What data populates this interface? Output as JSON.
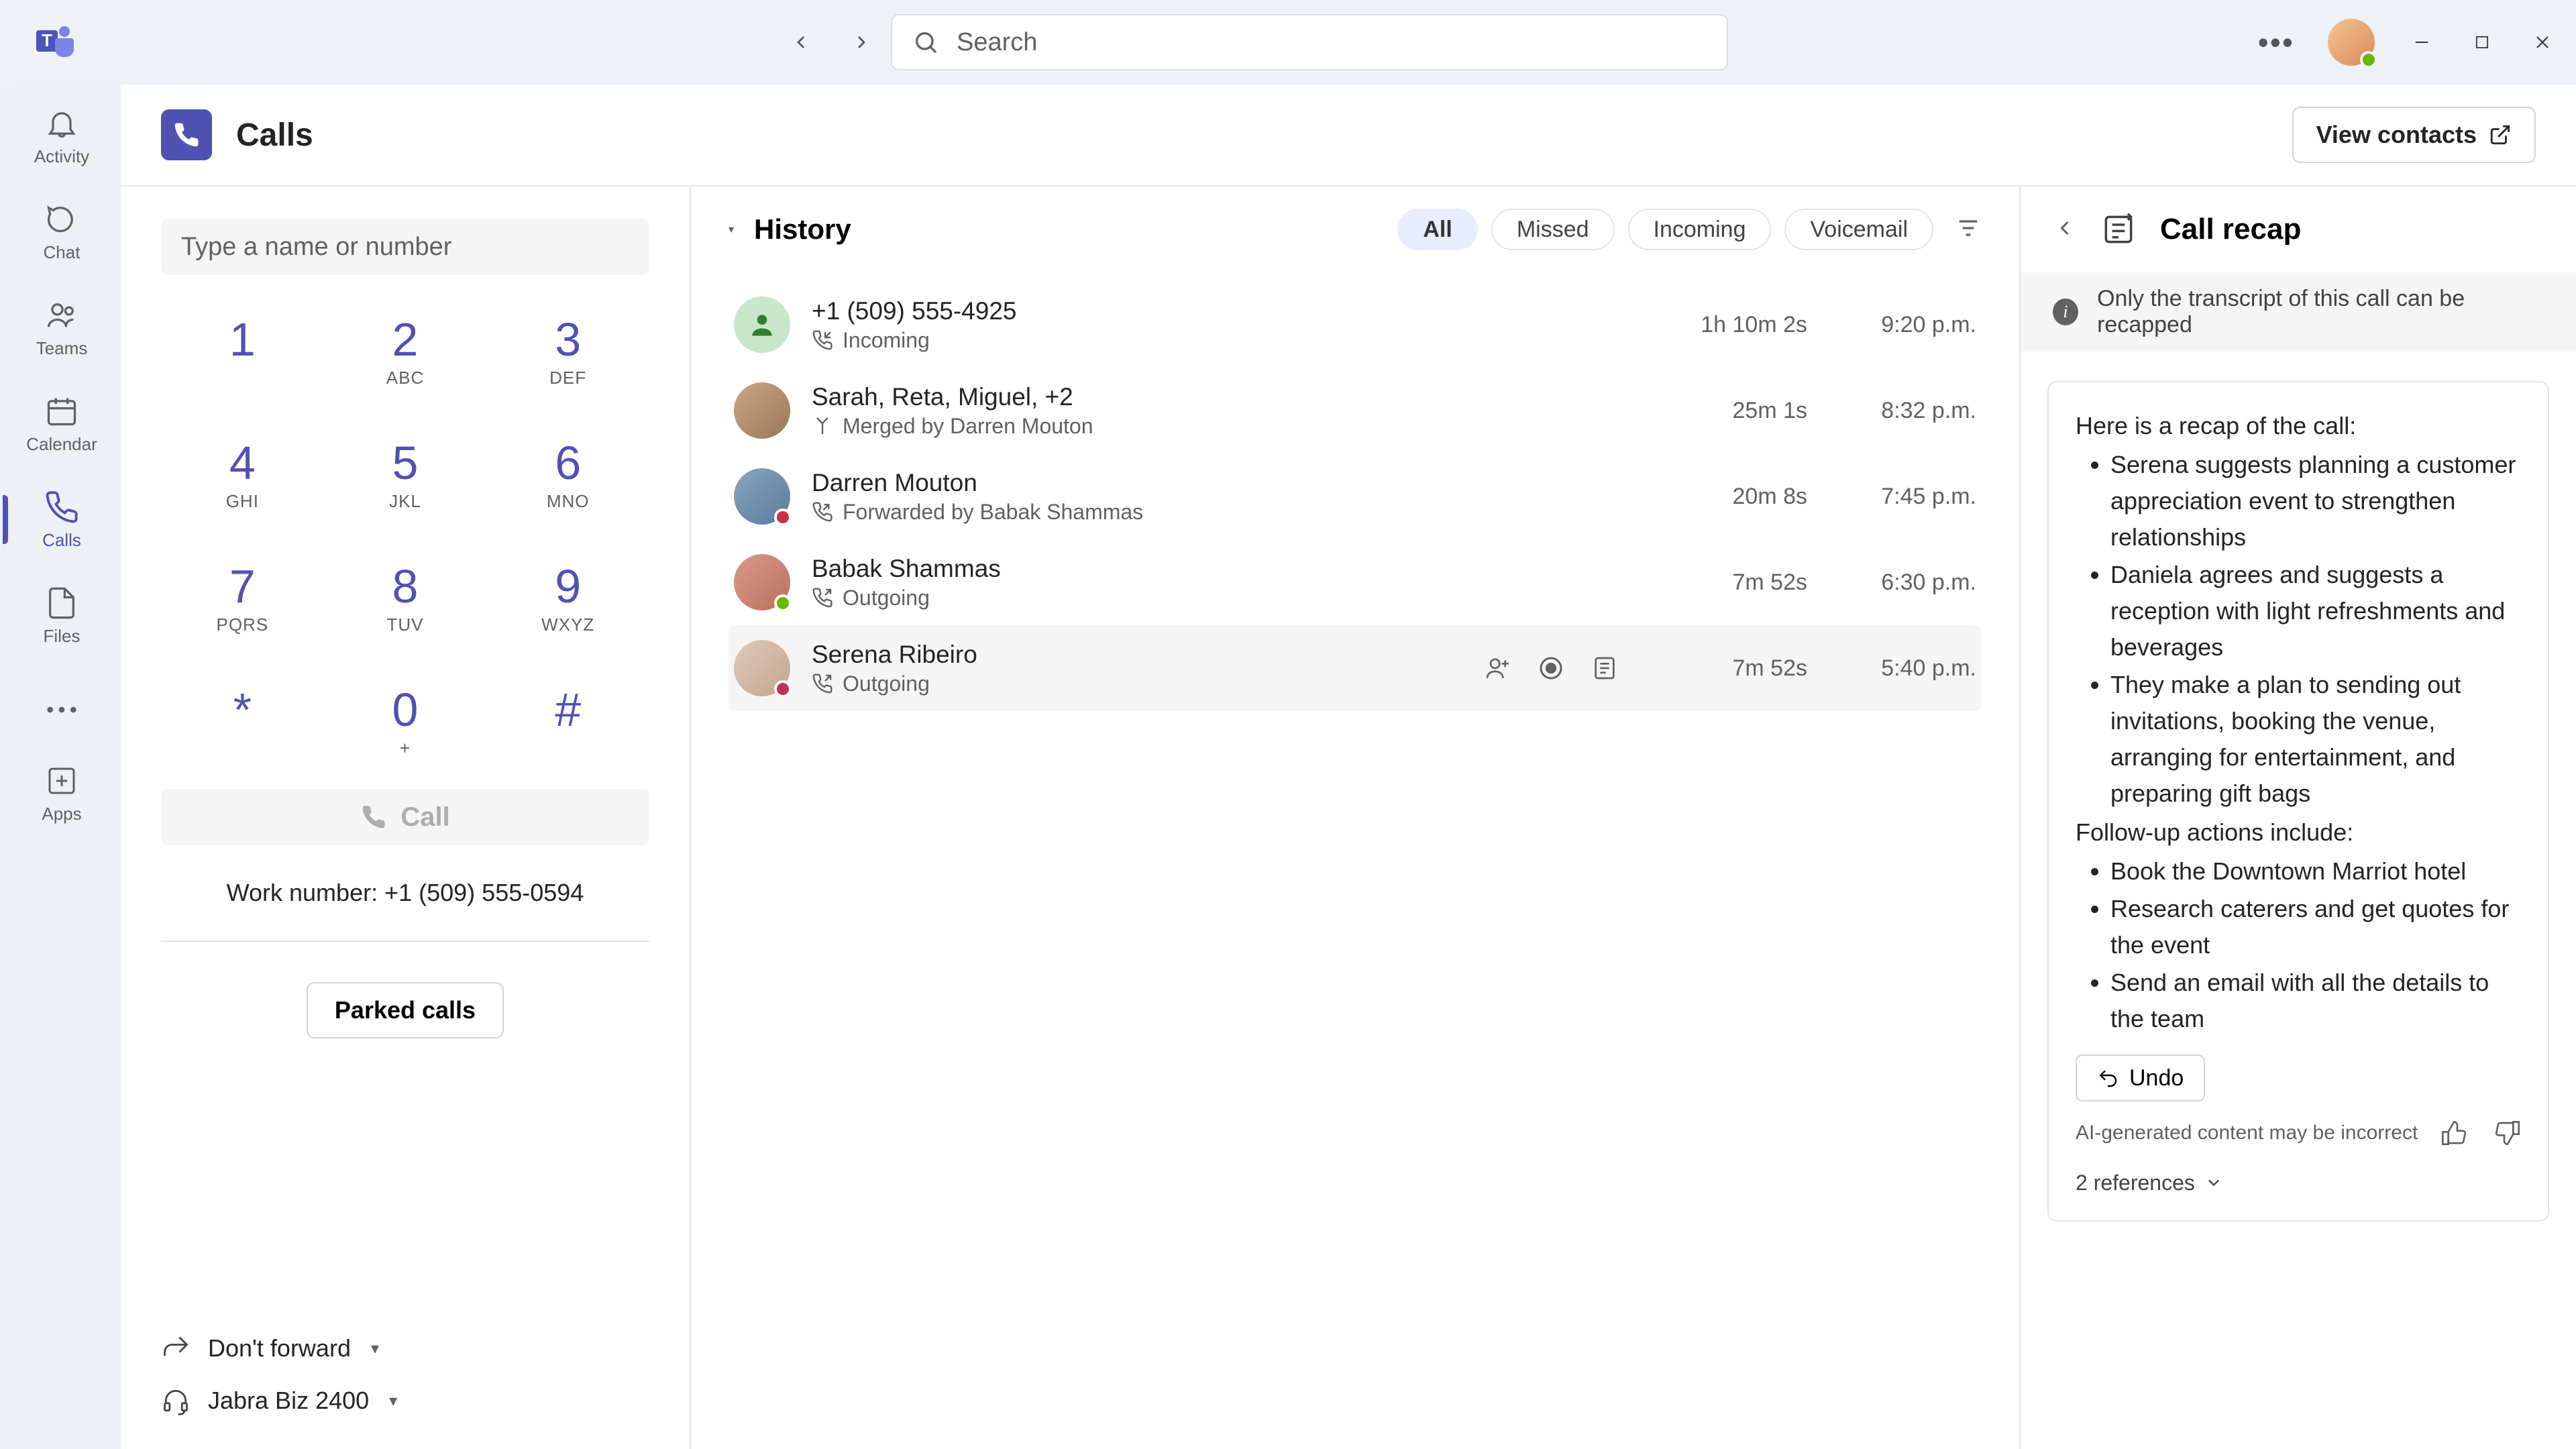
{
  "titlebar": {
    "search_placeholder": "Search"
  },
  "rail": {
    "items": [
      {
        "label": "Activity"
      },
      {
        "label": "Chat"
      },
      {
        "label": "Teams"
      },
      {
        "label": "Calendar"
      },
      {
        "label": "Calls"
      },
      {
        "label": "Files"
      }
    ],
    "apps_label": "Apps"
  },
  "header": {
    "title": "Calls",
    "view_contacts": "View contacts"
  },
  "dialer": {
    "input_placeholder": "Type a name or number",
    "keys": [
      {
        "d": "1",
        "l": ""
      },
      {
        "d": "2",
        "l": "ABC"
      },
      {
        "d": "3",
        "l": "DEF"
      },
      {
        "d": "4",
        "l": "GHI"
      },
      {
        "d": "5",
        "l": "JKL"
      },
      {
        "d": "6",
        "l": "MNO"
      },
      {
        "d": "7",
        "l": "PQRS"
      },
      {
        "d": "8",
        "l": "TUV"
      },
      {
        "d": "9",
        "l": "WXYZ"
      },
      {
        "d": "*",
        "l": ""
      },
      {
        "d": "0",
        "l": "+"
      },
      {
        "d": "#",
        "l": ""
      }
    ],
    "call_label": "Call",
    "work_number": "Work number: +1 (509) 555-0594",
    "parked_label": "Parked calls",
    "forward_label": "Don't forward",
    "device_label": "Jabra Biz 2400"
  },
  "history": {
    "title": "History",
    "filters": {
      "all": "All",
      "missed": "Missed",
      "incoming": "Incoming",
      "voicemail": "Voicemail"
    },
    "rows": [
      {
        "name": "+1 (509) 555-4925",
        "sub": "Incoming",
        "dur": "1h 10m 2s",
        "time": "9:20 p.m."
      },
      {
        "name": "Sarah, Reta, Miguel, +2",
        "sub": "Merged by Darren Mouton",
        "dur": "25m 1s",
        "time": "8:32 p.m."
      },
      {
        "name": "Darren Mouton",
        "sub": "Forwarded by Babak Shammas",
        "dur": "20m 8s",
        "time": "7:45 p.m."
      },
      {
        "name": "Babak Shammas",
        "sub": "Outgoing",
        "dur": "7m 52s",
        "time": "6:30 p.m."
      },
      {
        "name": "Serena Ribeiro",
        "sub": "Outgoing",
        "dur": "7m 52s",
        "time": "5:40 p.m."
      }
    ]
  },
  "recap": {
    "title": "Call recap",
    "banner": "Only the transcript of this call can be recapped",
    "intro": "Here is a recap of the call:",
    "points": [
      "Serena suggests planning a customer appreciation event to strengthen relationships",
      "Daniela agrees and suggests a reception with light refreshments and beverages",
      "They make a plan to sending out invitations, booking the venue, arranging for entertainment, and preparing gift bags"
    ],
    "followup_intro": "Follow-up actions include:",
    "followups": [
      "Book the Downtown Marriot hotel",
      "Research caterers and get quotes for the event",
      "Send an email with all the details to the team"
    ],
    "undo": "Undo",
    "disclaimer": "AI-generated content may be incorrect",
    "refs": "2 references"
  }
}
